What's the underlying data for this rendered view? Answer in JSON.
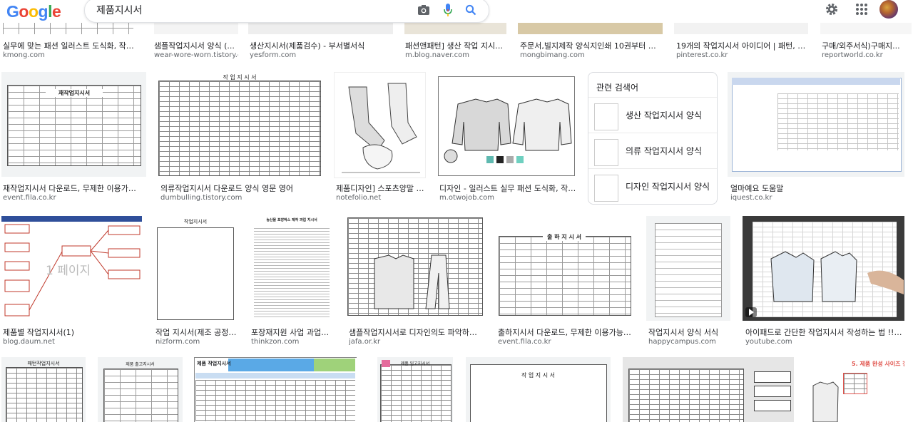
{
  "header": {
    "logo": "Google",
    "query": "제품지시서"
  },
  "related": {
    "title": "관련 검색어",
    "items": [
      {
        "label": "생산 작업지시서 양식"
      },
      {
        "label": "의류 작업지시서 양식"
      },
      {
        "label": "디자인 작업지시서 양식"
      }
    ]
  },
  "rows": {
    "row0": [
      {
        "caption": "실무에 맞는 패션 일러스트 도식화, 작업...",
        "source": "kmong.com"
      },
      {
        "caption": "샘플작업지시서 양식 (...",
        "source": "wear-wore-worn.tistory.c..."
      },
      {
        "caption": "생산지시서(제품검수) - 부서별서식",
        "source": "yesform.com"
      },
      {
        "caption": "패션앤패턴] 생산 작업 지시서...",
        "source": "m.blog.naver.com"
      },
      {
        "caption": "주문서,빌지제작 양식지인쇄 10권부터 소...",
        "source": "mongbimang.com"
      },
      {
        "caption": "19개의 작업지시서 아이디어 | 패턴, 드...",
        "source": "pinterest.co.kr"
      },
      {
        "caption": "구매/외주서식)구매지...",
        "source": "reportworld.co.kr"
      }
    ],
    "row1": [
      {
        "caption": "재작업지시서 다운로드, 무제한 이용가능, ...",
        "source": "event.fila.co.kr",
        "doc": "재작업지시서"
      },
      {
        "caption": "의류작업지시서 다운로드 양식 영문 영어",
        "source": "dumbulling.tistory.com",
        "doc": "작 업 지 시 서"
      },
      {
        "caption": "제품디자인] 스포츠양말 b...",
        "source": "notefolio.net"
      },
      {
        "caption": "디자인 - 일러스트 실무 패션 도식화, 작업...",
        "source": "m.otwojob.com"
      },
      {
        "caption": "얼마예요 도움말",
        "source": "iquest.co.kr"
      }
    ],
    "row2": [
      {
        "caption": "제품별 작업지시서(1)",
        "source": "blog.daum.net",
        "doc": "1 페이지"
      },
      {
        "caption": "작업 지시서(제조 공정) ...",
        "source": "nizform.com",
        "doc": "작업지시서"
      },
      {
        "caption": "포장재지원 사업 과업지...",
        "source": "thinkzon.com",
        "doc": "농산물 포장박스 제작 과업 지시서"
      },
      {
        "caption": "샘플작업지시서로 디자인의도 파악하기 ...",
        "source": "jafa.or.kr"
      },
      {
        "caption": "출하지시서 다운로드, 무제한 이용가능, ...",
        "source": "event.fila.co.kr",
        "doc": "출 하 지 시 서"
      },
      {
        "caption": "작업지시서 양식 서식",
        "source": "happycampus.com"
      },
      {
        "caption": "아이패드로 간단한 작업지시서 작성하는 법 !! (...",
        "source": "youtube.com"
      }
    ],
    "row3": [
      {
        "doc": "패턴작업지시서"
      },
      {
        "doc": "제품 출고지시서"
      },
      {
        "doc": "제품 작업지시서"
      },
      {
        "doc": "제품 입고지시서"
      },
      {
        "doc": "작 업 지 시 서"
      },
      {
        "doc": ""
      },
      {
        "doc": "5. 제품 완성 사이즈 정보"
      }
    ]
  },
  "colors": {
    "google_blue": "#4285F4",
    "google_red": "#EA4335",
    "google_yellow": "#FBBC05",
    "google_green": "#34A853",
    "icon_grey": "#5f6368",
    "border": "#dfe1e5"
  }
}
